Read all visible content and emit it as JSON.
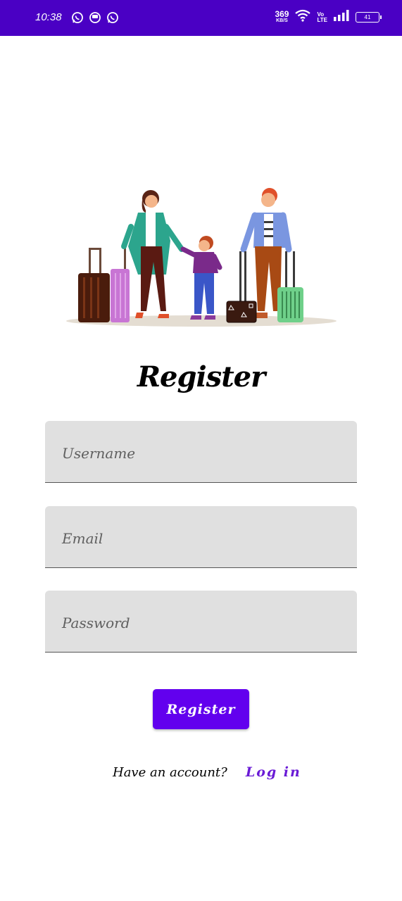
{
  "status_bar": {
    "time": "10:38",
    "net_speed_value": "369",
    "net_speed_unit": "KB/S",
    "volte_top": "Vo",
    "volte_bottom": "LTE",
    "battery_level": "41",
    "left_icons": [
      "whatsapp-icon",
      "messaging-icon",
      "whatsapp-icon"
    ],
    "right_icons": [
      "wifi-icon",
      "volte-icon",
      "signal-icon",
      "battery-icon"
    ],
    "background_color": "#4a00c4"
  },
  "illustration": {
    "icon": "family-travel-illustration"
  },
  "page": {
    "title": "Register"
  },
  "form": {
    "username_placeholder": "Username",
    "email_placeholder": "Email",
    "password_placeholder": "Password",
    "submit_label": "Register"
  },
  "footer": {
    "prompt": "Have an account?",
    "login_label": "Log in"
  },
  "colors": {
    "accent": "#6200ee",
    "link": "#6a1bd6",
    "field_background": "#e0e0e0"
  }
}
